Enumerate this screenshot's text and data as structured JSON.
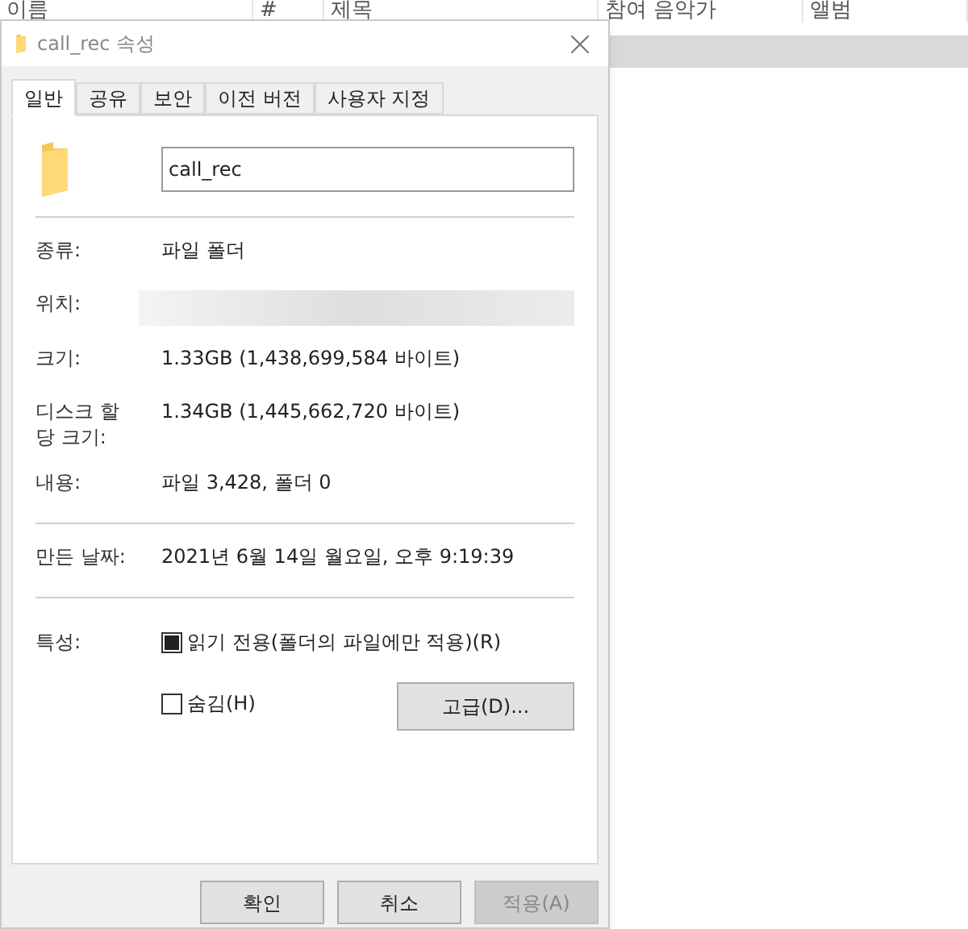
{
  "explorer": {
    "columns": [
      "이름",
      "#",
      "제목",
      "참여 음악가",
      "앨범"
    ],
    "selected_row": true
  },
  "dialog": {
    "title": "call_rec 속성",
    "tabs": [
      {
        "label": "일반",
        "selected": true
      },
      {
        "label": "공유",
        "selected": false
      },
      {
        "label": "보안",
        "selected": false
      },
      {
        "label": "이전 버전",
        "selected": false
      },
      {
        "label": "사용자 지정",
        "selected": false
      }
    ],
    "name_field": {
      "value": "call_rec"
    },
    "groups": [
      [
        {
          "label": "종류:",
          "value": "파일 폴더"
        },
        {
          "label": "위치:",
          "redacted": true
        },
        {
          "label": "크기:",
          "value": "1.33GB (1,438,699,584 바이트)"
        },
        {
          "label": "디스크 할\n당 크기:",
          "value": "1.34GB (1,445,662,720 바이트)"
        },
        {
          "label": "내용:",
          "value": "파일 3,428, 폴더 0"
        }
      ],
      [
        {
          "label": "만든 날짜:",
          "value": "2021년 6월 14일 월요일, 오후 9:19:39"
        }
      ]
    ],
    "attributes": {
      "label": "특성:",
      "options": [
        {
          "label": "읽기 전용(폴더의 파일에만 적용)(R)",
          "checked": false,
          "mixed": true
        },
        {
          "label": "숨김(H)",
          "checked": false,
          "mixed": false
        }
      ],
      "advanced_button": "고급(D)..."
    },
    "buttons": [
      {
        "label": "확인",
        "disabled": false
      },
      {
        "label": "취소",
        "disabled": false
      },
      {
        "label": "적용(A)",
        "disabled": true
      }
    ]
  }
}
